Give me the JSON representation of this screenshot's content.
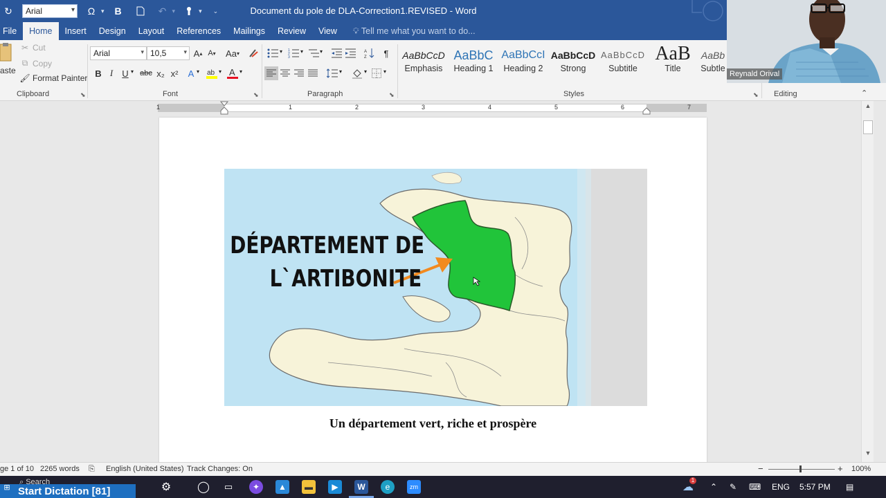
{
  "window": {
    "title": "Document du pole de DLA-Correction1.REVISED - Word"
  },
  "qat": {
    "font_value": "Arial",
    "omega_glyph": "Ω",
    "bold_glyph": "B"
  },
  "tabs": [
    {
      "label": "File"
    },
    {
      "label": "Home"
    },
    {
      "label": "Insert"
    },
    {
      "label": "Design"
    },
    {
      "label": "Layout"
    },
    {
      "label": "References"
    },
    {
      "label": "Mailings"
    },
    {
      "label": "Review"
    },
    {
      "label": "View"
    }
  ],
  "tell_me": {
    "placeholder": "Tell me what you want to do..."
  },
  "clipboard": {
    "paste_label": "aste",
    "cut_label": "Cut",
    "copy_label": "Copy",
    "format_painter_label": "Format Painter",
    "group_label": "Clipboard"
  },
  "font": {
    "name_value": "Arial",
    "size_value": "10,5",
    "group_label": "Font",
    "buttons": {
      "bold": "B",
      "italic": "I",
      "underline": "U",
      "strike": "abc",
      "subscript": "x₂",
      "superscript": "x²",
      "grow": "A^",
      "shrink": "Aˇ",
      "change_case": "Aa",
      "font_color": "A"
    },
    "font_color_hex": "#e81123",
    "highlight_hex": "#ffff00"
  },
  "paragraph": {
    "group_label": "Paragraph",
    "pilcrow": "¶"
  },
  "styles": {
    "group_label": "Styles",
    "items": [
      {
        "preview": "AaBbCcD",
        "name": "Emphasis"
      },
      {
        "preview": "AaBbC",
        "name": "Heading 1"
      },
      {
        "preview": "AaBbCcI",
        "name": "Heading 2"
      },
      {
        "preview": "AaBbCcD",
        "name": "Strong"
      },
      {
        "preview": "AaBbCcD",
        "name": "Subtitle"
      },
      {
        "preview": "AaB",
        "name": "Title"
      },
      {
        "preview": "AaBb",
        "name": "Subtle"
      }
    ]
  },
  "editing": {
    "group_label": "Editing"
  },
  "webcam": {
    "name": "Reynald Orival"
  },
  "ruler": {
    "numbers": [
      "1",
      "1",
      "2",
      "3",
      "4",
      "5",
      "6",
      "7"
    ]
  },
  "document": {
    "map_heading_line1": "DÉPARTEMENT DE",
    "map_heading_line2": "L`ARTIBONITE",
    "caption": "Un département vert, riche et prospère",
    "highlight_color": "#21c43a",
    "arrow_color": "#f28a1f",
    "sea_color": "#bfe3f3",
    "land_color": "#f7f3d9"
  },
  "statusbar": {
    "page": "ge 1 of 10",
    "words": "2265 words",
    "language": "English (United States)",
    "track_changes": "Track Changes: On",
    "zoom": "100%"
  },
  "taskbar": {
    "app_banner": "Start Dictation [81]",
    "search_placeholder": "Search",
    "language": "ENG",
    "time": "5:57 PM",
    "notification_count": "1"
  },
  "colors": {
    "word_blue": "#2b579a",
    "ribbon_bg": "#f3f3f3",
    "taskbar_bg": "#1f1f2e"
  }
}
